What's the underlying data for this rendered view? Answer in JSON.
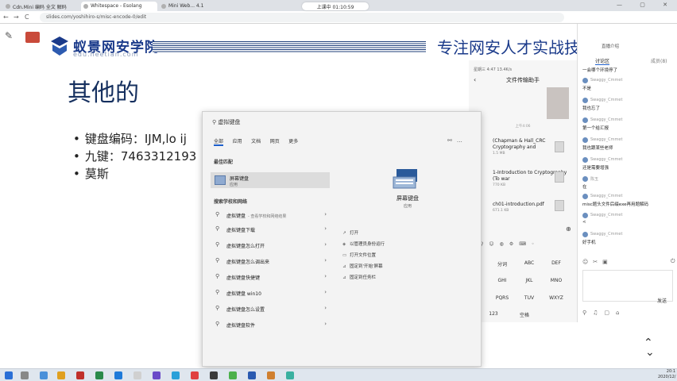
{
  "browser": {
    "tabs": [
      {
        "label": "Cdn.Mini 编码 全文 解码"
      },
      {
        "label": "Whitespace - Esolang"
      },
      {
        "label": "Mini Web... 4.1"
      }
    ],
    "url": "slides.com/yoshihiro-s/misc-encode-0/edit",
    "live_badge": "上课中 01:10:59",
    "back": "←",
    "forward": "→",
    "reload": "C"
  },
  "slide": {
    "logo_name": "蚁景网安学院",
    "logo_url": "edu.heetian.com",
    "slogan": "专注网安人才实战技",
    "title": "其他的",
    "bullets": [
      "键盘编码：IJM,lo ij",
      "九键：7463312193",
      "莫斯"
    ]
  },
  "start_menu": {
    "search_query": "虚拟键盘",
    "filter_tabs": [
      "全部",
      "应用",
      "文档",
      "网页",
      "更多"
    ],
    "best_match_heading": "最佳匹配",
    "best_match": {
      "title": "屏幕键盘",
      "subtitle": "应用"
    },
    "web_heading": "搜索学校和网络",
    "suggestions": [
      {
        "text": "虚拟键盘",
        "hint": "- 查看学校和网络结果"
      },
      {
        "text": "虚拟键盘下载",
        "hint": ""
      },
      {
        "text": "虚拟键盘怎么打开",
        "hint": ""
      },
      {
        "text": "虚拟键盘怎么调出来",
        "hint": ""
      },
      {
        "text": "虚拟键盘快捷键",
        "hint": ""
      },
      {
        "text": "虚拟键盘 win10",
        "hint": ""
      },
      {
        "text": "虚拟键盘怎么设置",
        "hint": ""
      },
      {
        "text": "虚拟键盘软件",
        "hint": ""
      }
    ],
    "app_name": "屏幕键盘",
    "app_type": "应用",
    "actions": [
      "打开",
      "以管理员身份运行",
      "打开文件位置",
      "固定到'开始'屏幕",
      "固定到任务栏"
    ]
  },
  "phone": {
    "status": "星期三 4:47 13.4K/s",
    "title": "文件传输助手",
    "timestamp": "上午4:06",
    "files": [
      {
        "name": "(Chapman & Hall_CRC Cryptography and",
        "meta": "1.5 MB"
      },
      {
        "name": "1-Introduction to Cryptography (To war",
        "meta": "770 KB"
      },
      {
        "name": "ch01-introduction.pdf",
        "meta": "671.1 KB"
      }
    ],
    "keys": [
      "分词",
      "ABC",
      "DEF",
      "GHI",
      "JKL",
      "MNO",
      "PQRS",
      "TUV",
      "WXYZ",
      "123",
      "空格"
    ]
  },
  "chat": {
    "header": "讨论区",
    "members": "成员(8)",
    "intro": "直播介绍",
    "messages": [
      {
        "name": "",
        "text": "一会哪个环境停了"
      },
      {
        "name": "Swaggy_Cmmet",
        "text": "不是"
      },
      {
        "name": "Swaggy_Cmmet",
        "text": "我也忘了"
      },
      {
        "name": "Swaggy_Cmmet",
        "text": "第一个给汇报"
      },
      {
        "name": "Swaggy_Cmmet",
        "text": "我也跟某些老师"
      },
      {
        "name": "Swaggy_Cmmet",
        "text": "还是需要增强"
      },
      {
        "name": "陈玉",
        "text": "在"
      },
      {
        "name": "Swaggy_Cmmet",
        "text": "misc题头文件后缀exe再用题解码"
      },
      {
        "name": "Swaggy_Cmmet",
        "text": "<"
      },
      {
        "name": "Swaggy_Cmmet",
        "text": "好手机"
      }
    ],
    "send_label": "发送"
  },
  "clock": {
    "time": "20:1",
    "date": "2020/12/"
  },
  "colors": {
    "brand_blue": "#1a3a8a",
    "title_blue": "#16305f",
    "accent": "#1e5fcc"
  }
}
